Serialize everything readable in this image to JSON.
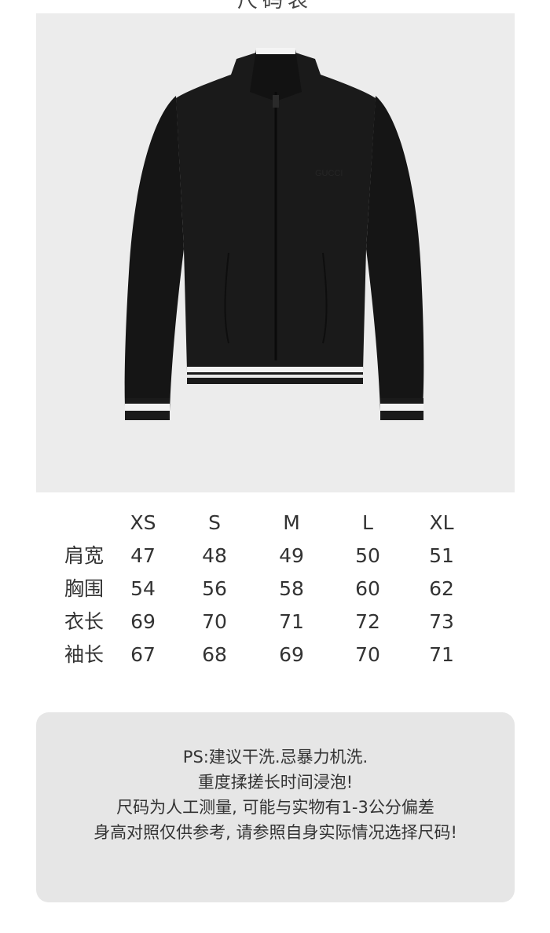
{
  "header": {
    "title": "尺码表"
  },
  "product": {
    "icon": "black-track-jacket-image",
    "chest_logo_text": "GUCCI"
  },
  "size_table": {
    "sizes": [
      "XS",
      "S",
      "M",
      "L",
      "XL"
    ],
    "rows": [
      {
        "label": "肩宽",
        "values": [
          "47",
          "48",
          "49",
          "50",
          "51"
        ]
      },
      {
        "label": "胸围",
        "values": [
          "54",
          "56",
          "58",
          "60",
          "62"
        ]
      },
      {
        "label": "衣长",
        "values": [
          "69",
          "70",
          "71",
          "72",
          "73"
        ]
      },
      {
        "label": "袖长",
        "values": [
          "67",
          "68",
          "69",
          "70",
          "71"
        ]
      }
    ]
  },
  "notes": {
    "lines": [
      "PS:建议干洗.忌暴力机洗.",
      "重度揉搓长时间浸泡!",
      "尺码为人工测量, 可能与实物有1-3公分偏差",
      "身高对照仅供参考, 请参照自身实际情况选择尺码!"
    ]
  }
}
